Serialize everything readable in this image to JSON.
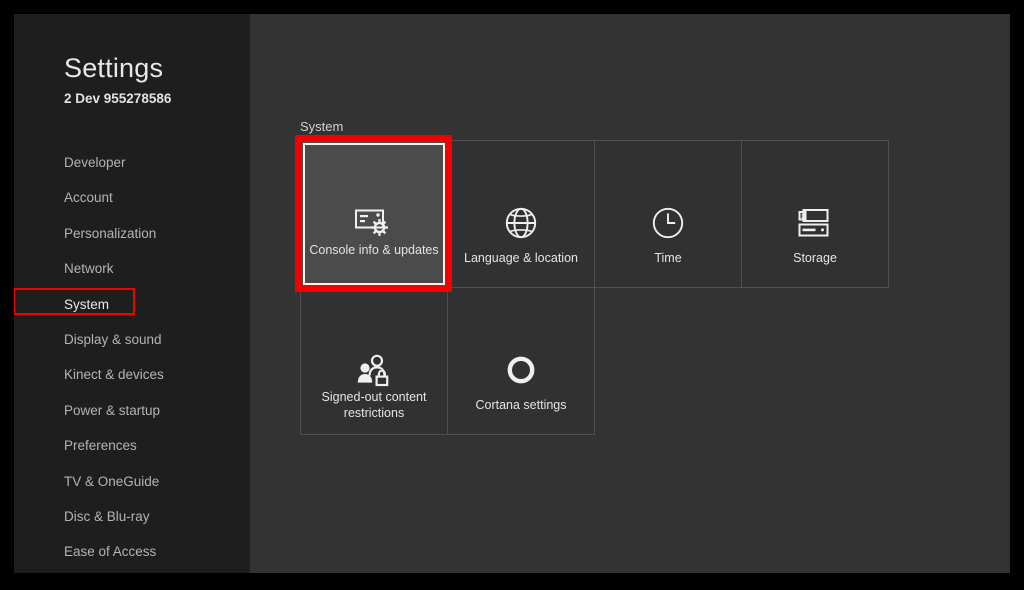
{
  "colors": {
    "frame": "#000000",
    "surface": "#333333",
    "sidebar": "#1e1e1e",
    "tile": "#313131",
    "tile_selected": "#4b4b4b",
    "grid_line": "#4f4f4f",
    "text_primary": "#e8e8e8",
    "text_secondary": "#b4b4b4",
    "annotation_red": "#f50000",
    "focus_ring": "#f2f2f2"
  },
  "sidebar": {
    "title": "Settings",
    "subtitle": "2 Dev 955278586",
    "items": [
      {
        "label": "Developer",
        "selected": false,
        "annotated": false
      },
      {
        "label": "Account",
        "selected": false,
        "annotated": false
      },
      {
        "label": "Personalization",
        "selected": false,
        "annotated": false
      },
      {
        "label": "Network",
        "selected": false,
        "annotated": false
      },
      {
        "label": "System",
        "selected": true,
        "annotated": true
      },
      {
        "label": "Display & sound",
        "selected": false,
        "annotated": false
      },
      {
        "label": "Kinect & devices",
        "selected": false,
        "annotated": false
      },
      {
        "label": "Power & startup",
        "selected": false,
        "annotated": false
      },
      {
        "label": "Preferences",
        "selected": false,
        "annotated": false
      },
      {
        "label": "TV & OneGuide",
        "selected": false,
        "annotated": false
      },
      {
        "label": "Disc & Blu-ray",
        "selected": false,
        "annotated": false
      },
      {
        "label": "Ease of Access",
        "selected": false,
        "annotated": false
      }
    ]
  },
  "main": {
    "group_label": "System",
    "tiles": [
      {
        "label": "Console info & updates",
        "icon": "console-gear-icon",
        "selected": true,
        "annotated": true,
        "two_line": true
      },
      {
        "label": "Language & location",
        "icon": "globe-icon",
        "selected": false,
        "annotated": false,
        "two_line": false
      },
      {
        "label": "Time",
        "icon": "clock-icon",
        "selected": false,
        "annotated": false,
        "two_line": false
      },
      {
        "label": "Storage",
        "icon": "storage-drives-icon",
        "selected": false,
        "annotated": false,
        "two_line": false
      },
      {
        "label": "Signed-out content restrictions",
        "icon": "people-lock-icon",
        "selected": false,
        "annotated": false,
        "two_line": true
      },
      {
        "label": "Cortana settings",
        "icon": "cortana-ring-icon",
        "selected": false,
        "annotated": false,
        "two_line": false
      }
    ]
  }
}
